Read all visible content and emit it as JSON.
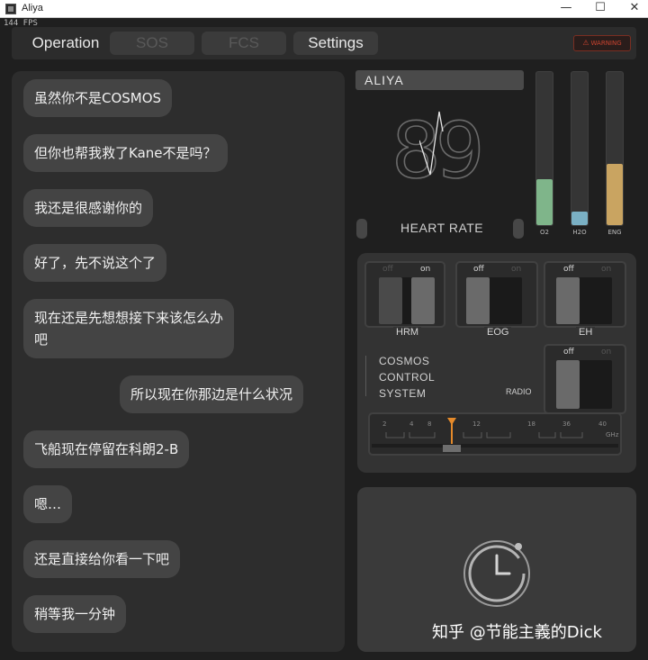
{
  "window": {
    "title": "Aliya",
    "fps": "144 FPS"
  },
  "tabs": [
    {
      "label": "Operation",
      "state": "active"
    },
    {
      "label": "SOS",
      "state": "disabled"
    },
    {
      "label": "FCS",
      "state": "disabled"
    },
    {
      "label": "Settings",
      "state": "active"
    }
  ],
  "warning_button": {
    "label": "WARNING",
    "icon": "warning-triangle-icon",
    "color": "#c9432f"
  },
  "chat": {
    "messages": [
      {
        "text": "虽然你不是COSMOS",
        "side": "left"
      },
      {
        "text": "但你也帮我救了Kane不是吗？",
        "side": "left"
      },
      {
        "text": "我还是很感谢你的",
        "side": "left"
      },
      {
        "text": "好了，先不说这个了",
        "side": "left"
      },
      {
        "text": "现在还是先想想接下来该怎么办\n吧",
        "side": "left"
      },
      {
        "text": "所以现在你那边是什么状况",
        "side": "right"
      },
      {
        "text": "飞船现在停留在科朗2-B",
        "side": "left"
      },
      {
        "text": "嗯…",
        "side": "left"
      },
      {
        "text": "还是直接给你看一下吧",
        "side": "left"
      },
      {
        "text": "稍等我一分钟",
        "side": "left"
      }
    ]
  },
  "vitals": {
    "name": "ALIYA",
    "heart_rate_value": "89",
    "heart_rate_label": "HEART RATE",
    "gauges": [
      {
        "label": "O2",
        "level": 0.3,
        "color": "#7fb58a"
      },
      {
        "label": "H2O",
        "level": 0.09,
        "color": "#7ab0c4"
      },
      {
        "label": "ENG",
        "level": 0.4,
        "color": "#c9a461"
      }
    ]
  },
  "controls": {
    "switches": [
      {
        "label": "HRM",
        "off": "off",
        "on": "on",
        "state": "on"
      },
      {
        "label": "EOG",
        "off": "off",
        "on": "on",
        "state": "off"
      },
      {
        "label": "EH",
        "off": "off",
        "on": "on",
        "state": "off"
      },
      {
        "label": "RADIO",
        "off": "off",
        "on": "on",
        "state": "off"
      }
    ],
    "system_name": [
      "COSMOS",
      "CONTROL",
      "SYSTEM"
    ],
    "radio": {
      "ticks": [
        "2",
        "4",
        "8",
        "12",
        "18",
        "36",
        "40"
      ],
      "unit": "GHz",
      "tuned_value": 10,
      "marker_color": "#e58a2a"
    }
  },
  "clock": {
    "icon": "clock-icon"
  },
  "watermark": "知乎 @节能主義的Dick"
}
